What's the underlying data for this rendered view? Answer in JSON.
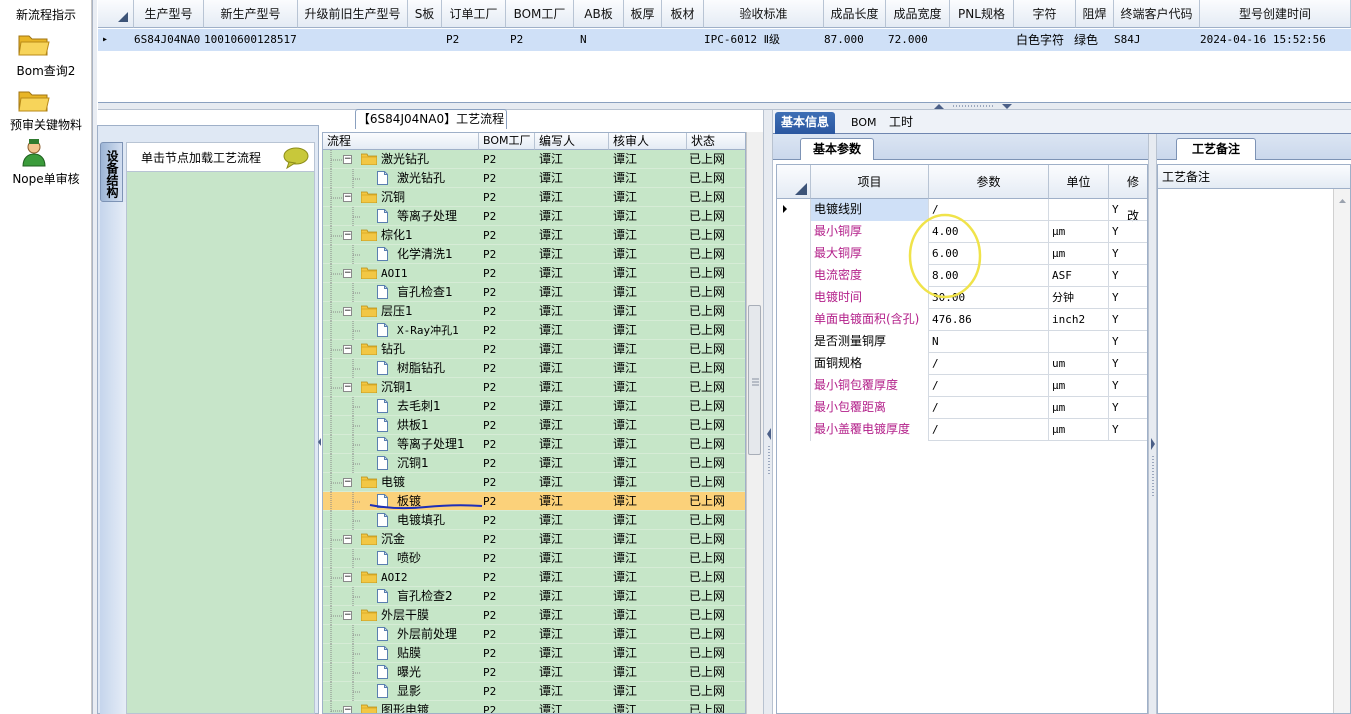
{
  "left_nav": {
    "items": [
      {
        "label": "新流程指示"
      },
      {
        "label": "Bom查询2"
      },
      {
        "label": "预审关键物料"
      },
      {
        "label": "Nope单审核"
      }
    ]
  },
  "top_grid": {
    "headers": [
      "生产型号",
      "新生产型号",
      "升级前旧生产型号",
      "S板",
      "订单工厂",
      "BOM工厂",
      "AB板",
      "板厚",
      "板材",
      "验收标准",
      "成品长度",
      "成品宽度",
      "PNL规格",
      "字符",
      "阻焊",
      "终端客户代码",
      "型号创建时间"
    ],
    "row": {
      "marker": "▸",
      "cells": [
        "6S84J04NA0",
        "10010600128517",
        "",
        "",
        "P2",
        "P2",
        "N",
        "",
        "",
        "IPC-6012 Ⅱ级",
        "87.000",
        "72.000",
        "",
        "白色字符",
        "绿色",
        "S84J",
        "2024-04-16 15:52:56"
      ]
    }
  },
  "flow_title": "【6S84J04NA0】工艺流程",
  "structure": {
    "tab_label": "设备结构",
    "hint": "单击节点加载工艺流程"
  },
  "tree": {
    "headers": [
      "流程",
      "BOM工厂",
      "编写人",
      "核审人",
      "状态"
    ],
    "rows": [
      {
        "level": 0,
        "name": "激光钻孔",
        "bom": "P2",
        "writer": "谭江",
        "reviewer": "谭江",
        "status": "已上网"
      },
      {
        "level": 1,
        "name": "激光钻孔",
        "bom": "P2",
        "writer": "谭江",
        "reviewer": "谭江",
        "status": "已上网"
      },
      {
        "level": 0,
        "name": "沉铜",
        "bom": "P2",
        "writer": "谭江",
        "reviewer": "谭江",
        "status": "已上网"
      },
      {
        "level": 1,
        "name": "等离子处理",
        "bom": "P2",
        "writer": "谭江",
        "reviewer": "谭江",
        "status": "已上网"
      },
      {
        "level": 0,
        "name": "棕化1",
        "bom": "P2",
        "writer": "谭江",
        "reviewer": "谭江",
        "status": "已上网"
      },
      {
        "level": 1,
        "name": "化学清洗1",
        "bom": "P2",
        "writer": "谭江",
        "reviewer": "谭江",
        "status": "已上网"
      },
      {
        "level": 0,
        "name": "AOI1",
        "bom": "P2",
        "writer": "谭江",
        "reviewer": "谭江",
        "status": "已上网"
      },
      {
        "level": 1,
        "name": "盲孔检查1",
        "bom": "P2",
        "writer": "谭江",
        "reviewer": "谭江",
        "status": "已上网"
      },
      {
        "level": 0,
        "name": "层压1",
        "bom": "P2",
        "writer": "谭江",
        "reviewer": "谭江",
        "status": "已上网"
      },
      {
        "level": 1,
        "name": "X-Ray冲孔1",
        "bom": "P2",
        "writer": "谭江",
        "reviewer": "谭江",
        "status": "已上网"
      },
      {
        "level": 0,
        "name": "钻孔",
        "bom": "P2",
        "writer": "谭江",
        "reviewer": "谭江",
        "status": "已上网"
      },
      {
        "level": 1,
        "name": "树脂钻孔",
        "bom": "P2",
        "writer": "谭江",
        "reviewer": "谭江",
        "status": "已上网"
      },
      {
        "level": 0,
        "name": "沉铜1",
        "bom": "P2",
        "writer": "谭江",
        "reviewer": "谭江",
        "status": "已上网"
      },
      {
        "level": 1,
        "name": "去毛刺1",
        "bom": "P2",
        "writer": "谭江",
        "reviewer": "谭江",
        "status": "已上网"
      },
      {
        "level": 1,
        "name": "烘板1",
        "bom": "P2",
        "writer": "谭江",
        "reviewer": "谭江",
        "status": "已上网"
      },
      {
        "level": 1,
        "name": "等离子处理1",
        "bom": "P2",
        "writer": "谭江",
        "reviewer": "谭江",
        "status": "已上网"
      },
      {
        "level": 1,
        "name": "沉铜1",
        "bom": "P2",
        "writer": "谭江",
        "reviewer": "谭江",
        "status": "已上网"
      },
      {
        "level": 0,
        "name": "电镀",
        "bom": "P2",
        "writer": "谭江",
        "reviewer": "谭江",
        "status": "已上网"
      },
      {
        "level": 1,
        "name": "板镀",
        "bom": "P2",
        "writer": "谭江",
        "reviewer": "谭江",
        "status": "已上网",
        "selected": true
      },
      {
        "level": 1,
        "name": "电镀填孔",
        "bom": "P2",
        "writer": "谭江",
        "reviewer": "谭江",
        "status": "已上网"
      },
      {
        "level": 0,
        "name": "沉金",
        "bom": "P2",
        "writer": "谭江",
        "reviewer": "谭江",
        "status": "已上网"
      },
      {
        "level": 1,
        "name": "喷砂",
        "bom": "P2",
        "writer": "谭江",
        "reviewer": "谭江",
        "status": "已上网"
      },
      {
        "level": 0,
        "name": "AOI2",
        "bom": "P2",
        "writer": "谭江",
        "reviewer": "谭江",
        "status": "已上网"
      },
      {
        "level": 1,
        "name": "盲孔检查2",
        "bom": "P2",
        "writer": "谭江",
        "reviewer": "谭江",
        "status": "已上网"
      },
      {
        "level": 0,
        "name": "外层干膜",
        "bom": "P2",
        "writer": "谭江",
        "reviewer": "谭江",
        "status": "已上网"
      },
      {
        "level": 1,
        "name": "外层前处理",
        "bom": "P2",
        "writer": "谭江",
        "reviewer": "谭江",
        "status": "已上网"
      },
      {
        "level": 1,
        "name": "贴膜",
        "bom": "P2",
        "writer": "谭江",
        "reviewer": "谭江",
        "status": "已上网"
      },
      {
        "level": 1,
        "name": "曝光",
        "bom": "P2",
        "writer": "谭江",
        "reviewer": "谭江",
        "status": "已上网"
      },
      {
        "level": 1,
        "name": "显影",
        "bom": "P2",
        "writer": "谭江",
        "reviewer": "谭江",
        "status": "已上网"
      },
      {
        "level": 0,
        "name": "图形电镀",
        "bom": "P2",
        "writer": "谭江",
        "reviewer": "谭江",
        "status": "已上网"
      }
    ]
  },
  "right_tabs": [
    "基本信息",
    "BOM",
    "工时"
  ],
  "param_subtab": "基本参数",
  "params": {
    "headers": [
      "项目",
      "参数",
      "单位",
      "修改"
    ],
    "rows": [
      {
        "item": "电镀线别",
        "value": "/",
        "unit": "",
        "mod": "Y",
        "pink": false,
        "current": true
      },
      {
        "item": "最小铜厚",
        "value": "4.00",
        "unit": "μm",
        "mod": "Y",
        "pink": true
      },
      {
        "item": "最大铜厚",
        "value": "6.00",
        "unit": "μm",
        "mod": "Y",
        "pink": true
      },
      {
        "item": "电流密度",
        "value": "8.00",
        "unit": "ASF",
        "mod": "Y",
        "pink": true
      },
      {
        "item": "电镀时间",
        "value": "30.00",
        "unit": "分钟",
        "mod": "Y",
        "pink": true
      },
      {
        "item": "单面电镀面积(含孔)",
        "value": "476.86",
        "unit": "inch2",
        "mod": "Y",
        "pink": true
      },
      {
        "item": "是否测量铜厚",
        "value": "N",
        "unit": "",
        "mod": "Y",
        "pink": false
      },
      {
        "item": "面铜规格",
        "value": "/",
        "unit": "um",
        "mod": "Y",
        "pink": false
      },
      {
        "item": "最小铜包覆厚度",
        "value": "/",
        "unit": "μm",
        "mod": "Y",
        "pink": true
      },
      {
        "item": "最小包覆距离",
        "value": "/",
        "unit": "μm",
        "mod": "Y",
        "pink": true
      },
      {
        "item": "最小盖覆电镀厚度",
        "value": "/",
        "unit": "μm",
        "mod": "Y",
        "pink": true
      }
    ]
  },
  "note_tab": "工艺备注",
  "note_header": "工艺备注",
  "colors": {
    "pink_text": "#b3208a",
    "selected_row": "#fbd17a",
    "tree_row": "#c6e6c8",
    "annotation_circle": "#f0e34a",
    "annotation_line": "#1d2fb8"
  }
}
